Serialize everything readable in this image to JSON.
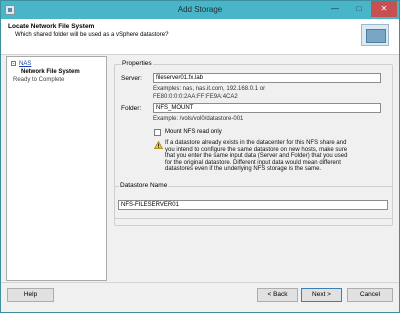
{
  "window": {
    "title": "Add Storage",
    "minimize_glyph": "—",
    "maximize_glyph": "□",
    "close_glyph": "✕"
  },
  "header": {
    "title": "Locate Network File System",
    "subtitle": "Which shared folder will be used as a vSphere datastore?"
  },
  "steps": {
    "expander_glyph": "-",
    "items": [
      {
        "label": "NAS"
      },
      {
        "label": "Network File System"
      },
      {
        "label": "Ready to Complete"
      }
    ]
  },
  "properties": {
    "legend": "Properties",
    "server_label": "Server:",
    "server_value": "fileserver01.fx.lab",
    "server_hint_1": "Examples: nas, nas.it.com, 192.168.0.1 or",
    "server_hint_2": "FE80:0:0:0:2AA:FF:FE9A:4CA2",
    "folder_label": "Folder:",
    "folder_value": "NFS_MOUNT",
    "folder_hint": "Example: /vols/vol0/datastore-001",
    "readonly_label": "Mount NFS read only",
    "readonly_checked": false,
    "warning": "If a datastore already exists in the datacenter for this NFS share and you intend to configure the same datastore on new hosts, make sure that you enter the same input data (Server and Folder) that you used for the original datastore. Different input data would mean different datastores even if the underlying NFS storage is the same."
  },
  "datastore": {
    "legend": "Datastore Name",
    "value": "NFS-FILESERVER01"
  },
  "footer": {
    "help": "Help",
    "back": "< Back",
    "next": "Next >",
    "cancel": "Cancel"
  }
}
